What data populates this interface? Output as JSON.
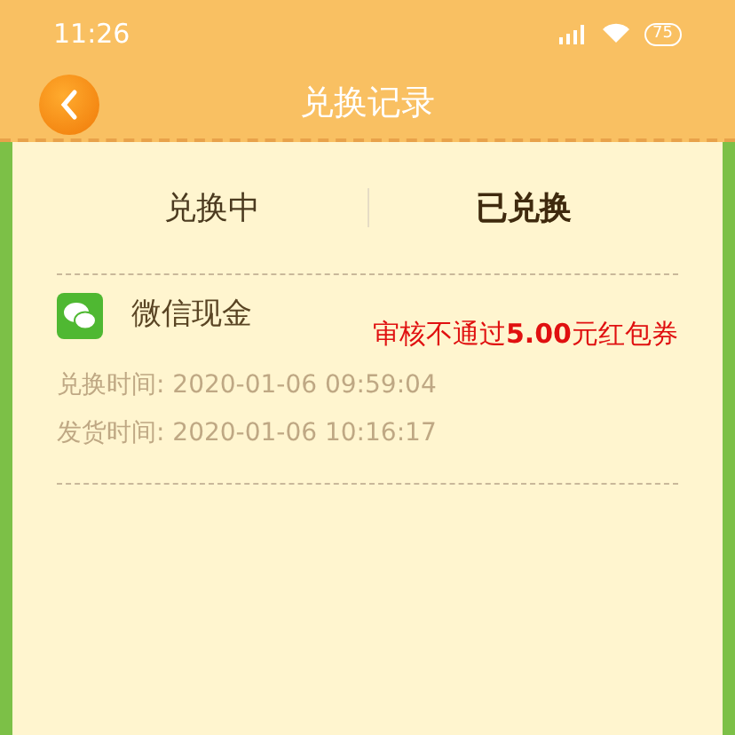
{
  "status_bar": {
    "time": "11:26",
    "battery": "75"
  },
  "header": {
    "title": "兑换记录"
  },
  "tabs": [
    {
      "label": "兑换中",
      "selected": false
    },
    {
      "label": "已兑换",
      "selected": true
    }
  ],
  "records": [
    {
      "name": "微信现金",
      "status": "审核不通过**5.00**元红包券",
      "lines": [
        "兑换时间: 2020-01-06 09:59:04",
        "发货时间: 2020-01-06 10:16:17"
      ]
    }
  ]
}
